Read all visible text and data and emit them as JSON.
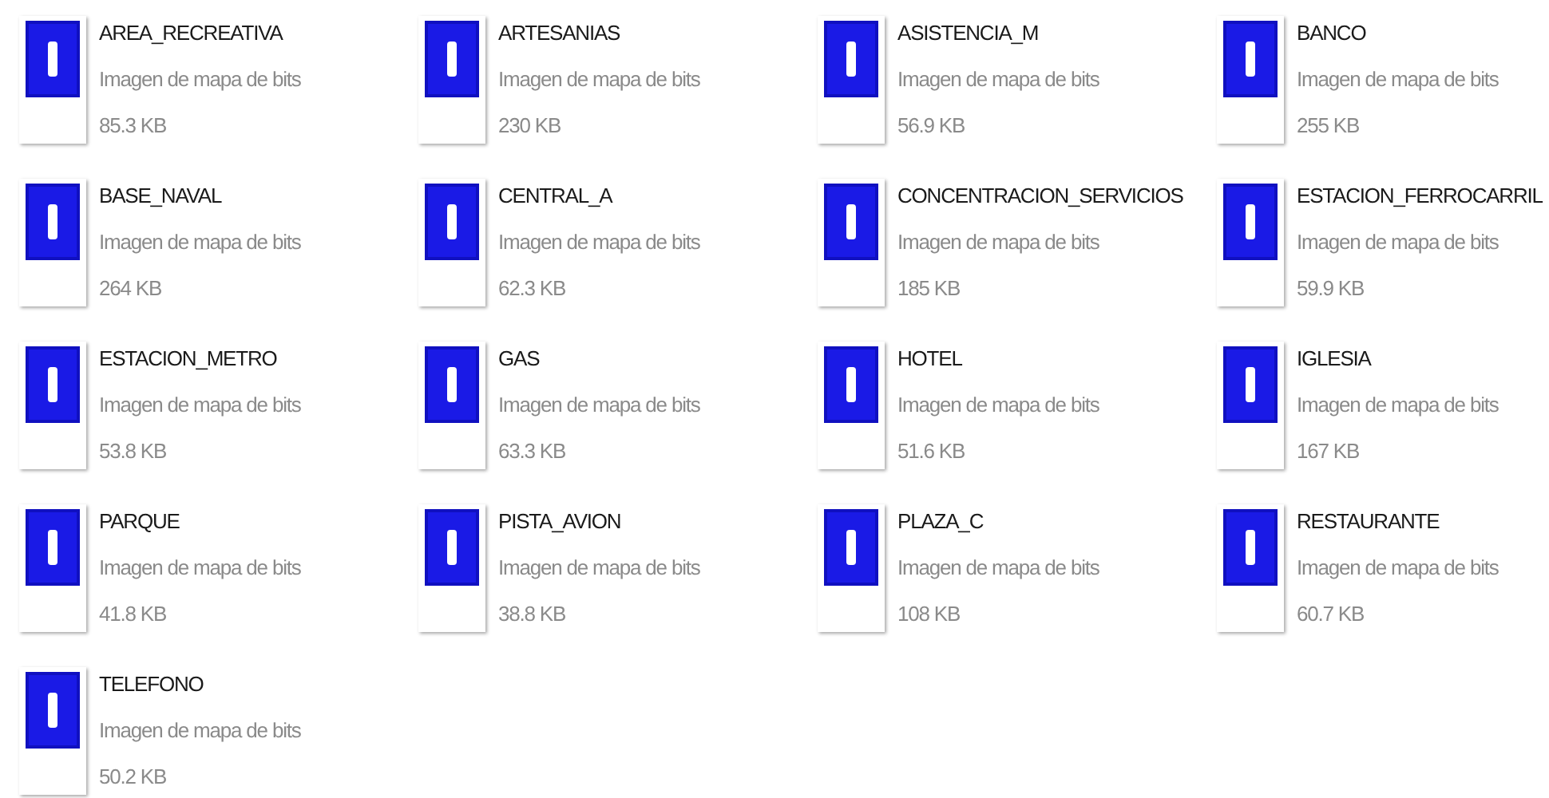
{
  "files": [
    {
      "name": "AREA_RECREATIVA",
      "type": "Imagen de mapa de bits",
      "size": "85.3 KB"
    },
    {
      "name": "ARTESANIAS",
      "type": "Imagen de mapa de bits",
      "size": "230 KB"
    },
    {
      "name": "ASISTENCIA_M",
      "type": "Imagen de mapa de bits",
      "size": "56.9 KB"
    },
    {
      "name": "BANCO",
      "type": "Imagen de mapa de bits",
      "size": "255 KB"
    },
    {
      "name": "BASE_NAVAL",
      "type": "Imagen de mapa de bits",
      "size": "264 KB"
    },
    {
      "name": "CENTRAL_A",
      "type": "Imagen de mapa de bits",
      "size": "62.3 KB"
    },
    {
      "name": "CONCENTRACION_SERVICIOS",
      "type": "Imagen de mapa de bits",
      "size": "185 KB"
    },
    {
      "name": "ESTACION_FERROCARRIL",
      "type": "Imagen de mapa de bits",
      "size": "59.9 KB"
    },
    {
      "name": "ESTACION_METRO",
      "type": "Imagen de mapa de bits",
      "size": "53.8 KB"
    },
    {
      "name": "GAS",
      "type": "Imagen de mapa de bits",
      "size": "63.3 KB"
    },
    {
      "name": "HOTEL",
      "type": "Imagen de mapa de bits",
      "size": "51.6 KB"
    },
    {
      "name": "IGLESIA",
      "type": "Imagen de mapa de bits",
      "size": "167 KB"
    },
    {
      "name": "PARQUE",
      "type": "Imagen de mapa de bits",
      "size": "41.8 KB"
    },
    {
      "name": "PISTA_AVION",
      "type": "Imagen de mapa de bits",
      "size": "38.8 KB"
    },
    {
      "name": "PLAZA_C",
      "type": "Imagen de mapa de bits",
      "size": "108 KB"
    },
    {
      "name": "RESTAURANTE",
      "type": "Imagen de mapa de bits",
      "size": "60.7 KB"
    },
    {
      "name": "TELEFONO",
      "type": "Imagen de mapa de bits",
      "size": "50.2 KB"
    }
  ]
}
